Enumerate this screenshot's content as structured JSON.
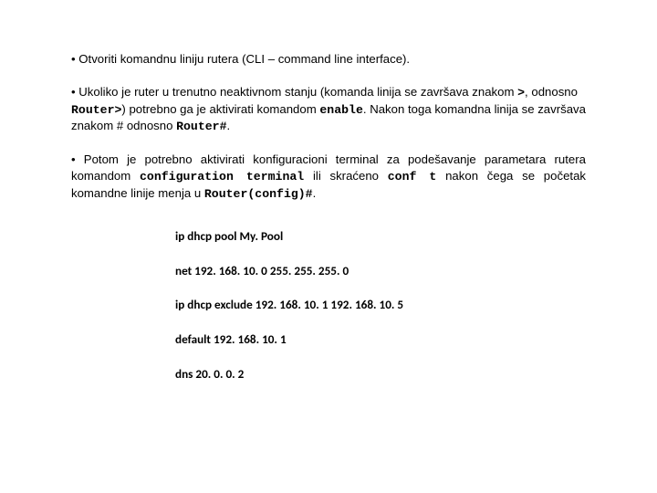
{
  "bullets": {
    "b1_pre": "• Otvoriti komandnu liniju rutera (CLI – command line interface).",
    "b2_pre": "• Ukoliko je ruter u trenutno neaktivnom stanju (komanda linija se završava znakom ",
    "b2_m1": ">",
    "b2_mid1": ", odnosno ",
    "b2_m2": "Router>",
    "b2_mid2": ")  potrebno ga je aktivirati komandom ",
    "b2_m3": "enable",
    "b2_mid3": ". Nakon toga komandna linija se završava znakom # odnosno ",
    "b2_m4": "Router#",
    "b2_end": ".",
    "b3_pre": "• Potom je potrebno aktivirati konfiguracioni terminal za podešavanje parametara rutera komandom ",
    "b3_m1": "configuration terminal",
    "b3_mid1": " ili skraćeno ",
    "b3_m2": "conf t",
    "b3_mid2": " nakon čega se početak komandne linije menja u ",
    "b3_m3": "Router(config)#",
    "b3_end": "."
  },
  "commands": {
    "c1": "ip dhcp pool My. Pool",
    "c2": "net 192. 168. 10. 0 255. 255. 255. 0",
    "c3": "ip dhcp exclude 192. 168. 10. 1 192. 168. 10. 5",
    "c4": "default 192. 168. 10. 1",
    "c5": "dns 20. 0. 0. 2"
  }
}
